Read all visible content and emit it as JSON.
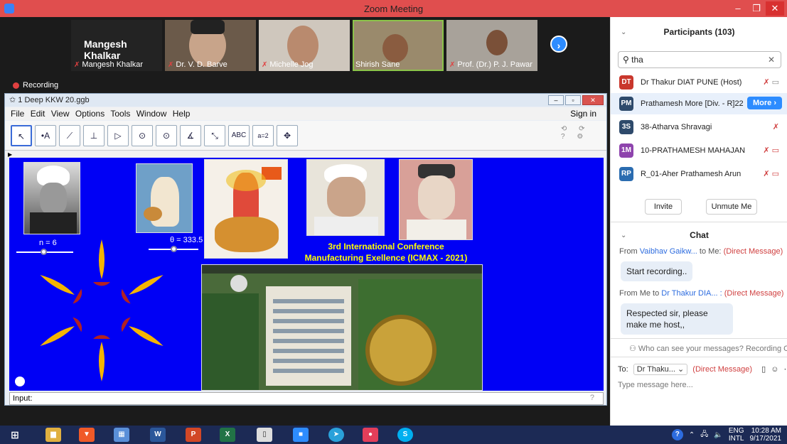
{
  "window": {
    "title": "Zoom Meeting",
    "min": "–",
    "max": "❐",
    "close": "✕"
  },
  "videos": {
    "speaker_name": "Mangesh Khalkar",
    "tiles": [
      {
        "label": "Mangesh Khalkar"
      },
      {
        "label": "Dr. V. D. Barve"
      },
      {
        "label": "Michelle Jog"
      },
      {
        "label": "Shirish Sane"
      },
      {
        "label": "Prof. (Dr.) P. J. Pawar"
      }
    ],
    "next_glyph": "›"
  },
  "recording": "Recording",
  "geogebra": {
    "file_title": "1 Deep KKW 20.ggb",
    "menu": [
      "File",
      "Edit",
      "View",
      "Options",
      "Tools",
      "Window",
      "Help"
    ],
    "sign_in": "Sign in",
    "tools": [
      "↖",
      "•A",
      "⟋",
      "⊥",
      "▷",
      "⊙",
      "⊙",
      "∡",
      "⤡",
      "ABC",
      "a=2",
      "✥"
    ],
    "slider_n": "n = 6",
    "slider_theta": "θ = 333.5",
    "conference_line1": "3rd International Conference",
    "conference_line2": "Manufacturing Exellence (ICMAX - 2021)",
    "input_label": "Input:",
    "help_glyph": "?"
  },
  "participants": {
    "title": "Participants (103)",
    "search_value": "tha",
    "clear_glyph": "✕",
    "list": [
      {
        "initials": "DT",
        "name": "Dr Thakur DIAT PUNE (Host)",
        "color": "#c9372c"
      },
      {
        "initials": "PM",
        "name": "Prathamesh More [Div. - R]22",
        "color": "#2e4a6b"
      },
      {
        "initials": "3S",
        "name": "38-Atharva Shravagi",
        "color": "#2e4a6b"
      },
      {
        "initials": "1M",
        "name": "10-PRATHAMESH MAHAJAN",
        "color": "#8e44ad"
      },
      {
        "initials": "RP",
        "name": "R_01-Aher Prathamesh Arun",
        "color": "#2b6cb0"
      }
    ],
    "more_label": "More ›",
    "invite": "Invite",
    "unmute_me": "Unmute Me"
  },
  "chat": {
    "title": "Chat",
    "msg1_from_prefix": "From",
    "msg1_from": "Vaibhav Gaikw...",
    "msg1_to": "to Me:",
    "msg1_dm": "(Direct Message)",
    "msg1_text": "Start recording..",
    "msg2_from_prefix": "From Me to",
    "msg2_to": "Dr Thakur DIA... :",
    "msg2_dm": "(Direct Message)",
    "msg2_text": "Respected sir, please make me host,,",
    "who_can_see": "Who can see your messages? Recording On",
    "to_label": "To:",
    "to_value": "Dr Thaku... ⌄",
    "to_dm": "(Direct Message)",
    "placeholder": "Type message here..."
  },
  "taskbar": {
    "lang": "ENG",
    "region": "INTL",
    "time": "10:28 AM",
    "date": "9/17/2021",
    "apps": [
      {
        "glyph": "⊞",
        "color": "#1c2a55"
      },
      {
        "glyph": "▆",
        "color": "#e0b040"
      },
      {
        "glyph": "▼",
        "color": "#f05a28"
      },
      {
        "glyph": "▦",
        "color": "#5a8fd8"
      },
      {
        "glyph": "W",
        "color": "#2b579a"
      },
      {
        "glyph": "P",
        "color": "#d24726"
      },
      {
        "glyph": "X",
        "color": "#217346"
      },
      {
        "glyph": "▯",
        "color": "#dddddd"
      },
      {
        "glyph": "■",
        "color": "#2d8cff"
      },
      {
        "glyph": "➤",
        "color": "#2aa1da"
      },
      {
        "glyph": "●",
        "color": "#e33e5a"
      },
      {
        "glyph": "S",
        "color": "#00aff0"
      }
    ]
  }
}
